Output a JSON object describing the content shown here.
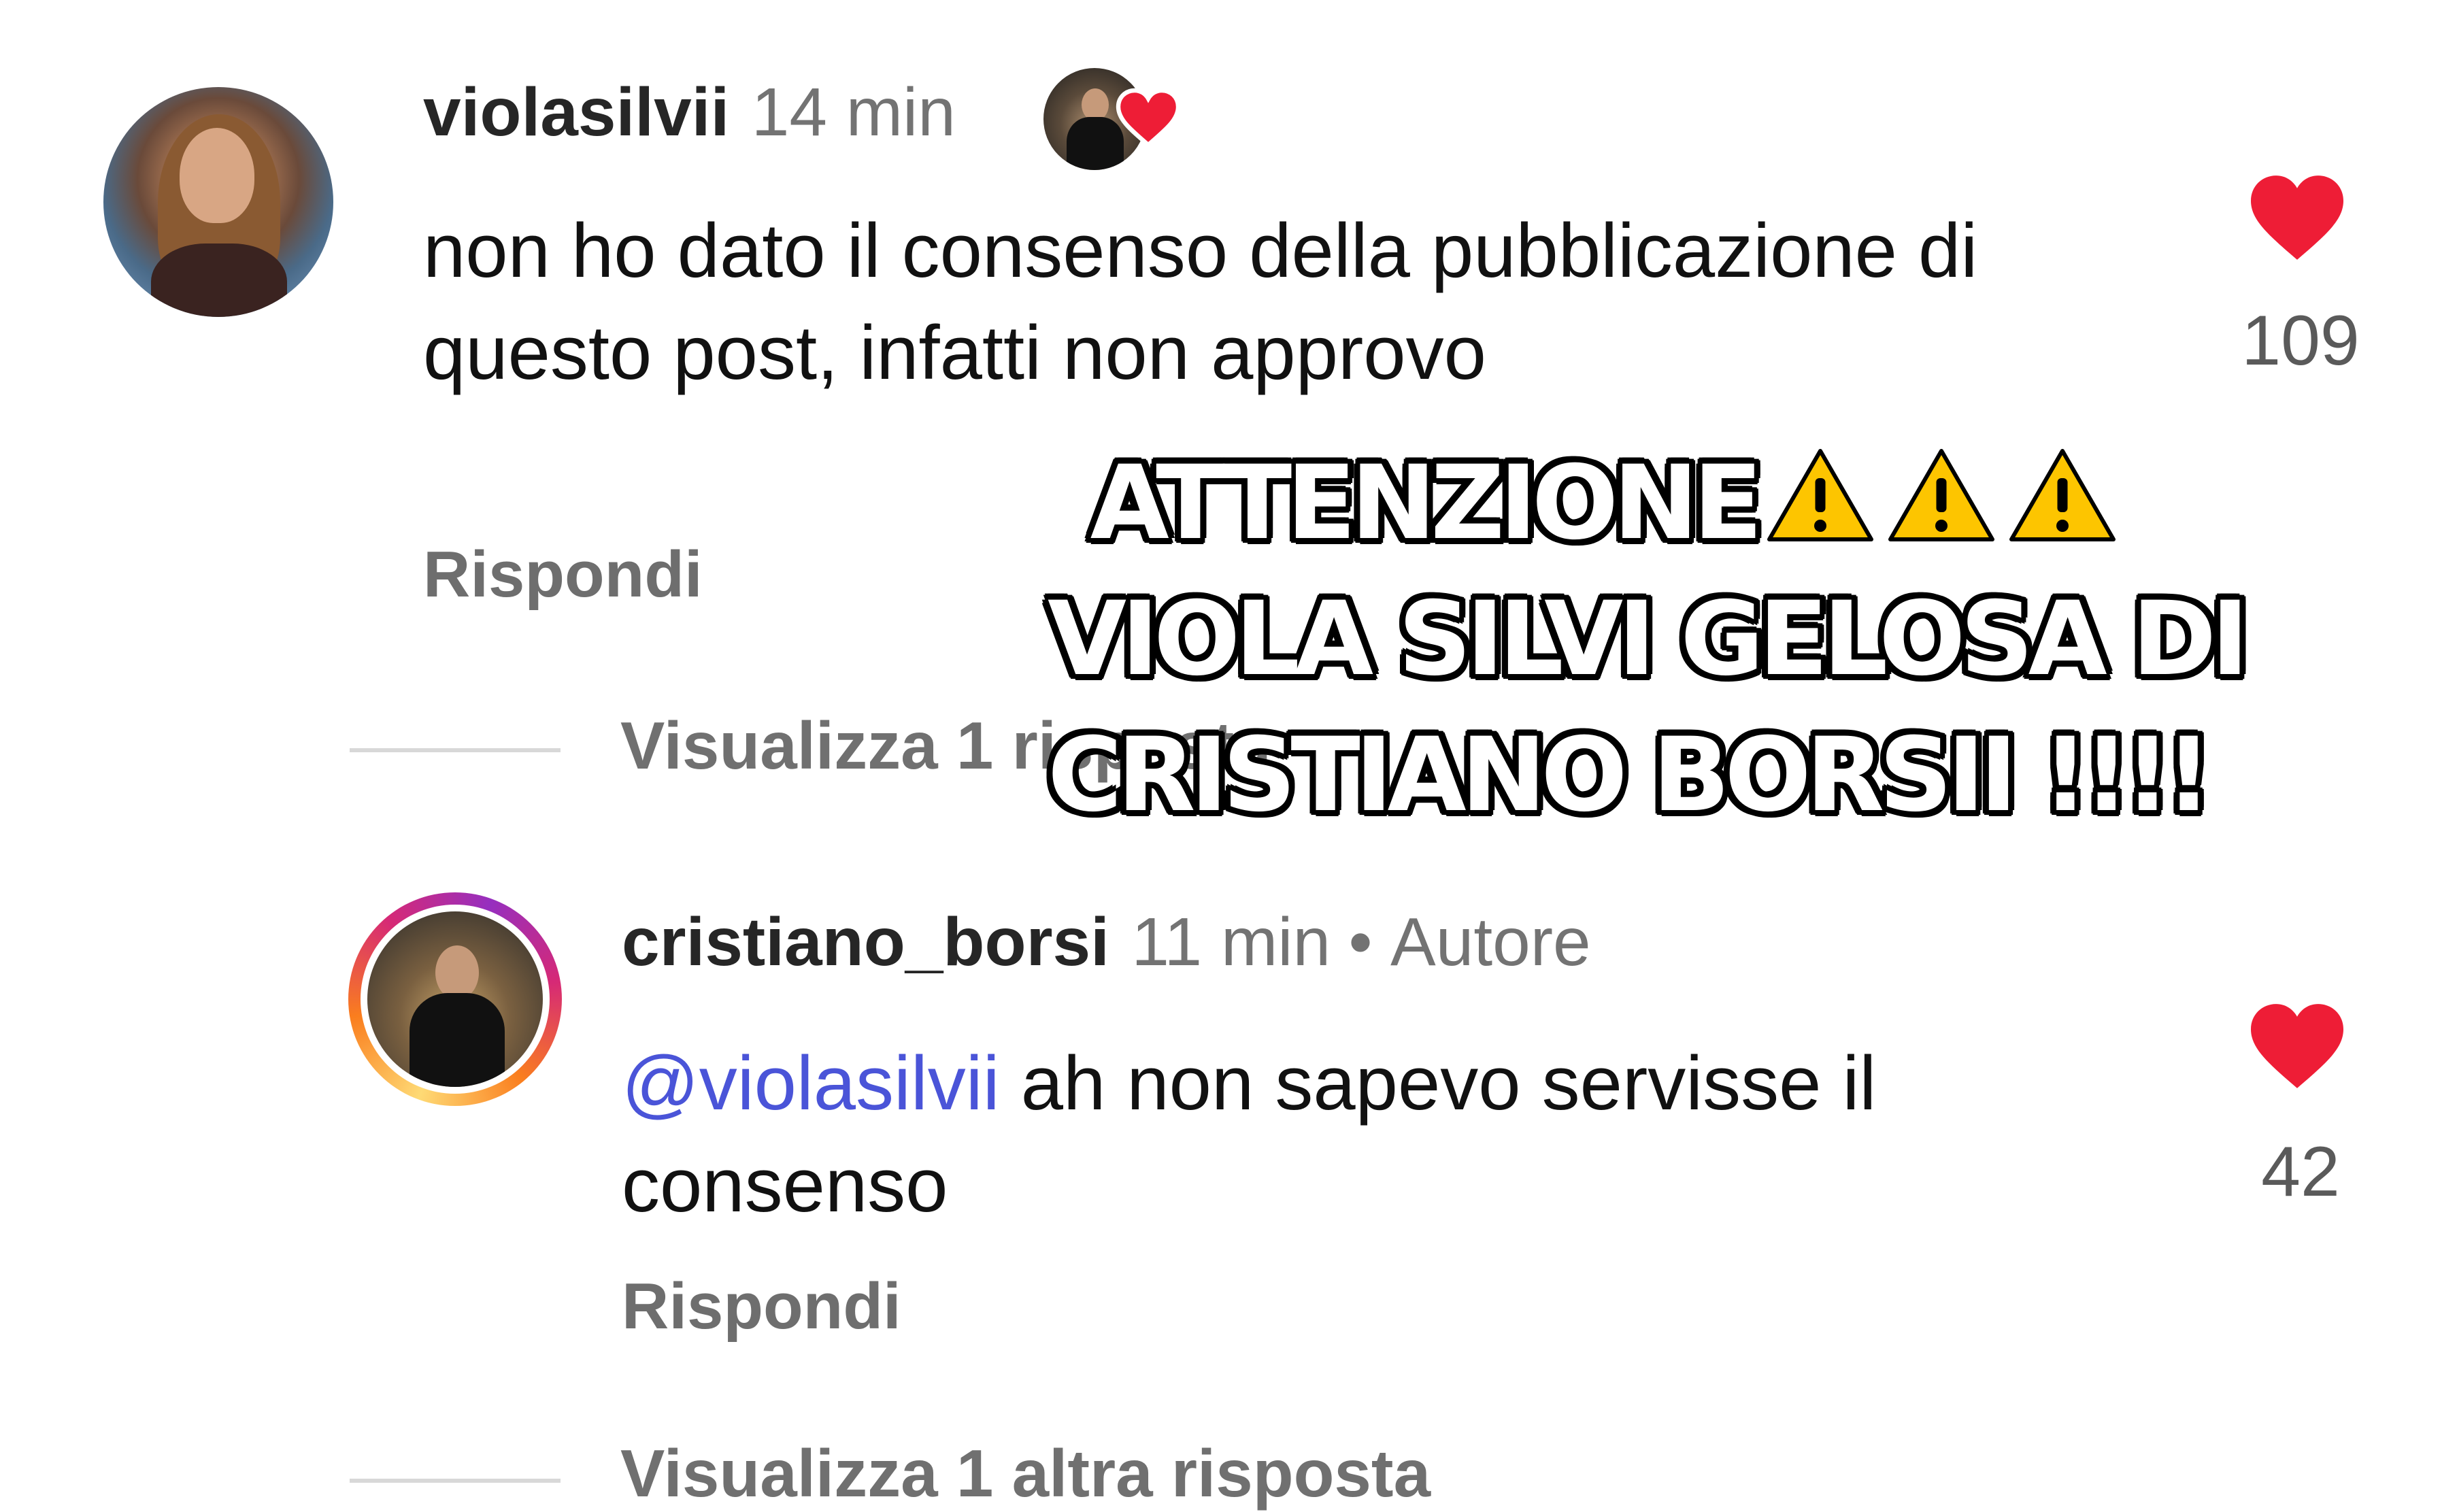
{
  "comments": [
    {
      "username": "violasilvii",
      "time": "14 min",
      "text": "non ho dato il consenso della pubblicazione di questo post, infatti non approvo",
      "reply_label": "Rispondi",
      "likes": "109",
      "liked_by_author": true,
      "view_replies": "Visualizza 1 risposta"
    },
    {
      "username": "cristiano_borsi",
      "time": "11 min",
      "separator": "•",
      "badge": "Autore",
      "mention": "@violasilvii",
      "text": " ah non sapevo servisse il consenso",
      "reply_label": "Rispondi",
      "likes": "42",
      "view_replies": "Visualizza 1 altra risposta"
    }
  ],
  "overlay": {
    "line1": "ATTENZIONE",
    "line2": "VIOLA SILVI GELOSA DI",
    "line3": "CRISTIANO BORSII !!!!"
  },
  "colors": {
    "like_red": "#ee1d36",
    "mention_blue": "#4a54d8",
    "warning_yellow": "#fdc500"
  },
  "icons": [
    "heart-icon",
    "warning-icon"
  ]
}
